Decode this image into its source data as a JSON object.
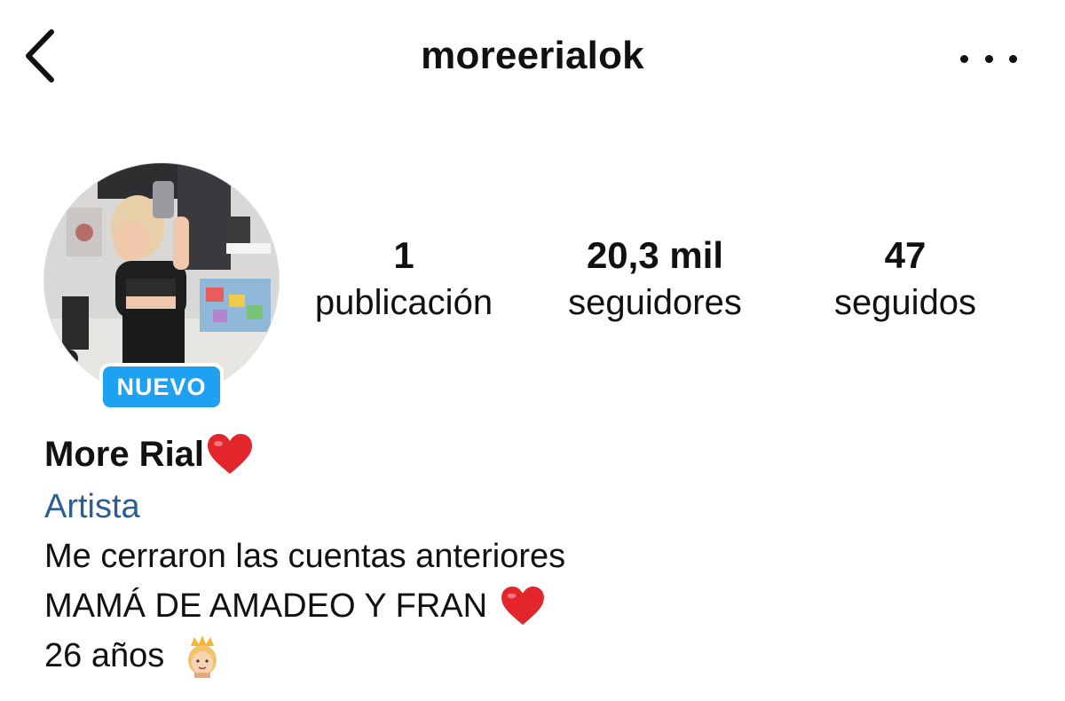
{
  "header": {
    "username": "moreerialok",
    "back_icon": "chevron-left-icon",
    "more_icon": "more-horizontal-icon"
  },
  "profile": {
    "badge": "NUEVO",
    "badge_color": "#1ea1f1",
    "stats": {
      "posts": {
        "value": "1",
        "label": "publicación"
      },
      "followers": {
        "value": "20,3 mil",
        "label": "seguidores"
      },
      "following": {
        "value": "47",
        "label": "seguidos"
      }
    },
    "display_name": "More Rial",
    "category": "Artista",
    "category_color": "#2b5f91",
    "bio": [
      "Me cerraron las cuentas anteriores",
      "MAMÁ DE AMADEO Y FRAN",
      "26 años"
    ],
    "name_emoji": "heart-icon",
    "bio_emojis": [
      "heart-icon",
      "princess-icon"
    ]
  }
}
